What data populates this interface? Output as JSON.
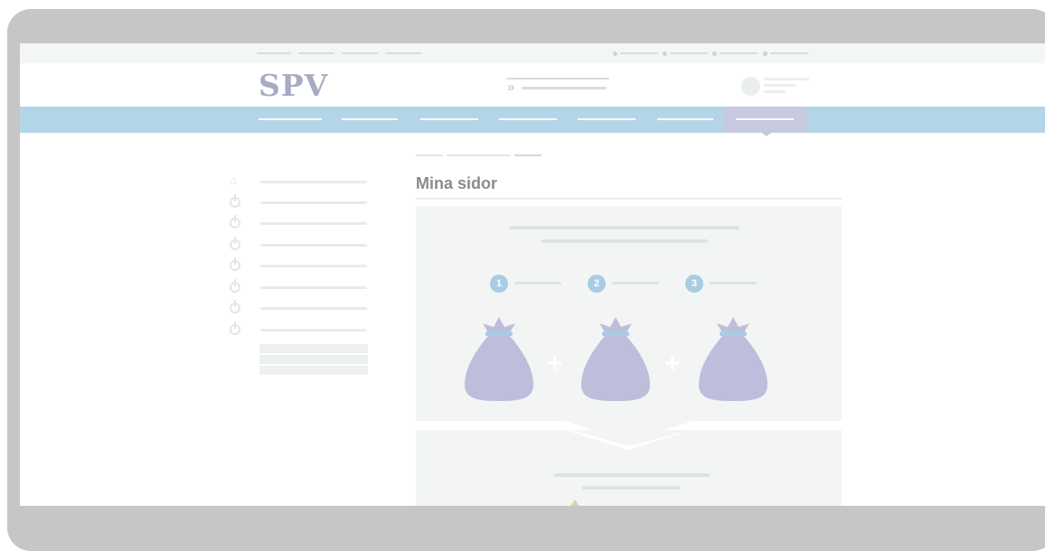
{
  "header": {
    "logo_text": "SPV",
    "search_icon_glyph": "»"
  },
  "main": {
    "page_title": "Mina sidor",
    "steps": [
      {
        "number": "1"
      },
      {
        "number": "2"
      },
      {
        "number": "3"
      }
    ],
    "plus_glyph": "+"
  },
  "colors": {
    "device_frame": "#c6c6c6",
    "nav_bar": "#b3d5e8",
    "nav_active": "#c6c9e0",
    "logo": "#a7abc4",
    "bag": "#bcbedc",
    "bag_band": "#a8cde3",
    "step_badge": "#a8cde3",
    "panel_bg": "#f3f5f5"
  },
  "icons": [
    "home-icon",
    "sidebar-bullet-icon",
    "chevron-right-icon",
    "avatar-icon",
    "money-bag-icon",
    "plus-icon"
  ]
}
